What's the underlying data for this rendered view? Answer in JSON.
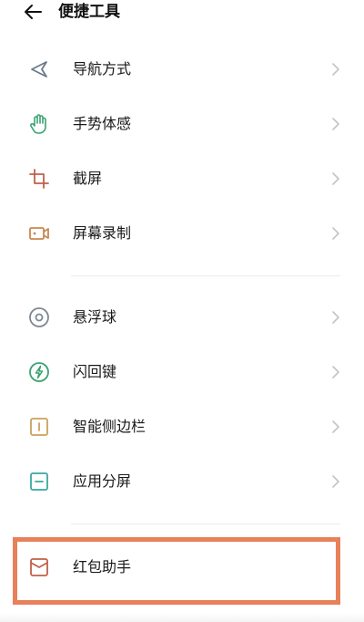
{
  "header": {
    "title": "便捷工具",
    "back_icon": "arrow-left-icon"
  },
  "colors": {
    "highlight_border": "#e8805a",
    "navigation_icon": "#6b7a8a",
    "gesture_icon": "#3aa372",
    "screenshot_icon": "#c0604a",
    "recording_icon": "#c9874f",
    "floating_ball_icon": "#7d8893",
    "flash_key_icon": "#3aa372",
    "sidebar_icon": "#c9a25a",
    "split_screen_icon": "#3aa8a0",
    "red_packet_icon": "#c0604a"
  },
  "group1": [
    {
      "label": "导航方式",
      "icon": "navigation-arrow-icon"
    },
    {
      "label": "手势体感",
      "icon": "hand-gesture-icon"
    },
    {
      "label": "截屏",
      "icon": "crop-icon"
    },
    {
      "label": "屏幕录制",
      "icon": "video-camera-icon"
    }
  ],
  "group2": [
    {
      "label": "悬浮球",
      "icon": "floating-ball-icon"
    },
    {
      "label": "闪回键",
      "icon": "lightning-icon"
    },
    {
      "label": "智能侧边栏",
      "icon": "sidebar-icon"
    },
    {
      "label": "应用分屏",
      "icon": "split-screen-icon"
    }
  ],
  "group3": [
    {
      "label": "红包助手",
      "icon": "envelope-icon",
      "highlighted": true
    }
  ]
}
